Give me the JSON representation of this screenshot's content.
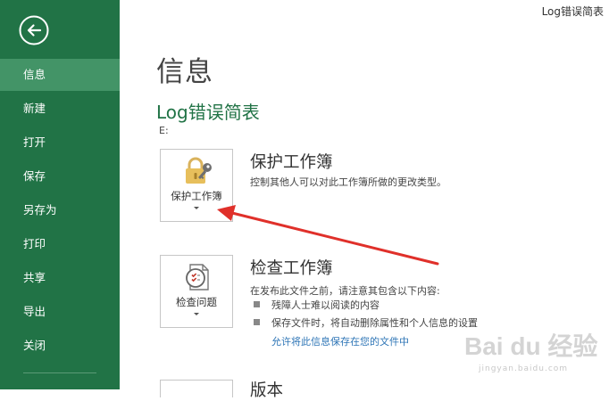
{
  "window": {
    "file_title": "Log错误简表"
  },
  "sidebar": {
    "items": [
      {
        "label": "信息"
      },
      {
        "label": "新建"
      },
      {
        "label": "打开"
      },
      {
        "label": "保存"
      },
      {
        "label": "另存为"
      },
      {
        "label": "打印"
      },
      {
        "label": "共享"
      },
      {
        "label": "导出"
      },
      {
        "label": "关闭"
      }
    ]
  },
  "main": {
    "title": "信息",
    "doc_name": "Log错误简表",
    "doc_path": "E:",
    "protect": {
      "tile_label": "保护工作簿",
      "title": "保护工作簿",
      "description": "控制其他人可以对此工作簿所做的更改类型。"
    },
    "inspect": {
      "tile_label": "检查问题",
      "title": "检查工作簿",
      "description": "在发布此文件之前，请注意其包含以下内容:",
      "bullets": [
        "残障人士难以阅读的内容",
        "保存文件时，将自动删除属性和个人信息的设置"
      ],
      "link": "允许将此信息保存在您的文件中"
    },
    "versions": {
      "title": "版本"
    }
  },
  "watermark": {
    "brand": "Bai du 经验",
    "url": "jingyan.baidu.com"
  },
  "colors": {
    "sidebar": "#217346",
    "sidebar_selected": "#439467",
    "accent_text": "#217346",
    "arrow": "#e0302a",
    "link": "#2e75b6"
  }
}
